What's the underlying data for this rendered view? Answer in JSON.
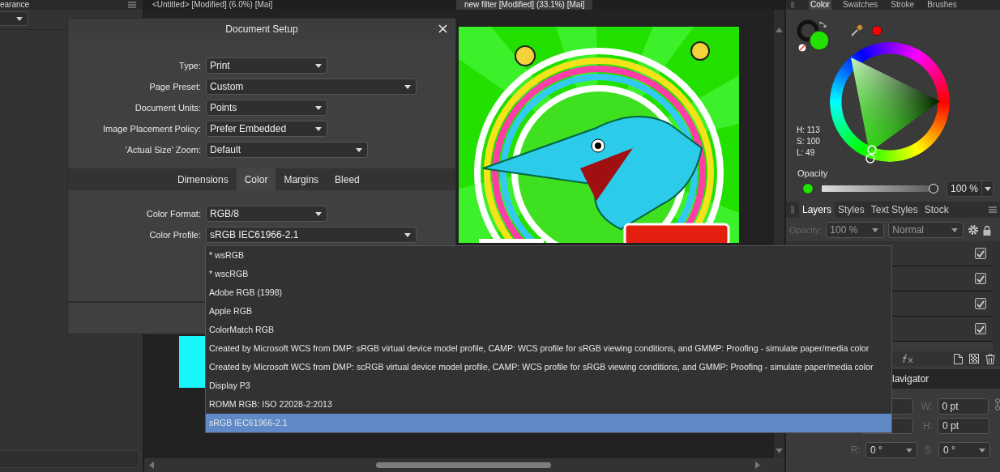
{
  "left_panel": {
    "tab": "earance"
  },
  "documents": [
    {
      "title": "<Untitled> [Modified] (6.0%) [Mai]",
      "selected": false
    },
    {
      "title": "new filter [Modified] (33.1%) [Mai]",
      "selected": true
    }
  ],
  "dialog": {
    "title": "Document Setup",
    "fields": [
      {
        "label": "Type:",
        "value": "Print"
      },
      {
        "label": "Page Preset:",
        "value": "Custom"
      },
      {
        "label": "Document Units:",
        "value": "Points"
      },
      {
        "label": "Image Placement Policy:",
        "value": "Prefer Embedded"
      },
      {
        "label": "'Actual Size' Zoom:",
        "value": "Default"
      }
    ],
    "tabs": [
      {
        "label": "Dimensions",
        "selected": false
      },
      {
        "label": "Color",
        "selected": true
      },
      {
        "label": "Margins",
        "selected": false
      },
      {
        "label": "Bleed",
        "selected": false
      }
    ],
    "color_fields": [
      {
        "label": "Color Format:",
        "value": "RGB/8"
      },
      {
        "label": "Color Profile:",
        "value": "sRGB IEC61966-2.1"
      }
    ],
    "profile_options": [
      {
        "label": "* wsRGB",
        "selected": false
      },
      {
        "label": "* wscRGB",
        "selected": false
      },
      {
        "label": "Adobe RGB (1998)",
        "selected": false
      },
      {
        "label": "Apple RGB",
        "selected": false
      },
      {
        "label": "ColorMatch RGB",
        "selected": false
      },
      {
        "label": "Created by Microsoft WCS from DMP: sRGB virtual device model profile, CAMP: WCS profile for sRGB viewing conditions, and GMMP: Proofing - simulate paper/media color",
        "selected": false
      },
      {
        "label": "Created by Microsoft WCS from DMP: scRGB virtual device model profile, CAMP: WCS profile for sRGB viewing conditions, and GMMP: Proofing - simulate paper/media color",
        "selected": false
      },
      {
        "label": "Display P3",
        "selected": false
      },
      {
        "label": "ROMM RGB: ISO 22028-2:2013",
        "selected": false
      },
      {
        "label": "sRGB IEC61966-2.1",
        "selected": true
      }
    ]
  },
  "color_panel": {
    "tabs": [
      {
        "label": "Color",
        "selected": true
      },
      {
        "label": "Swatches",
        "selected": false
      },
      {
        "label": "Stroke",
        "selected": false
      },
      {
        "label": "Brushes",
        "selected": false
      }
    ],
    "readouts": [
      "H: 113",
      "S: 100",
      "L: 49"
    ],
    "opacity_label": "Opacity",
    "opacity": {
      "level": 1,
      "reading": "100 %"
    }
  },
  "layers_panel": {
    "tabs": [
      {
        "label": "Layers",
        "selected": true
      },
      {
        "label": "Styles",
        "selected": false
      },
      {
        "label": "Text Styles",
        "selected": false
      },
      {
        "label": "Stock",
        "selected": false
      }
    ],
    "opacity_label": "Opacity:",
    "opacity_value": "100 %",
    "blend_mode": "Normal",
    "layers": [
      {
        "visible": true
      },
      {
        "visible": true
      },
      {
        "visible": true
      },
      {
        "visible": true
      }
    ]
  },
  "transform_panel": {
    "tab": "lavigator",
    "fields": [
      {
        "label": "W:",
        "value": "0 pt"
      },
      {
        "label": "H:",
        "value": "0 pt"
      },
      {
        "label": "R:",
        "value": "0 °"
      },
      {
        "label": "S:",
        "value": "0 °"
      }
    ]
  }
}
